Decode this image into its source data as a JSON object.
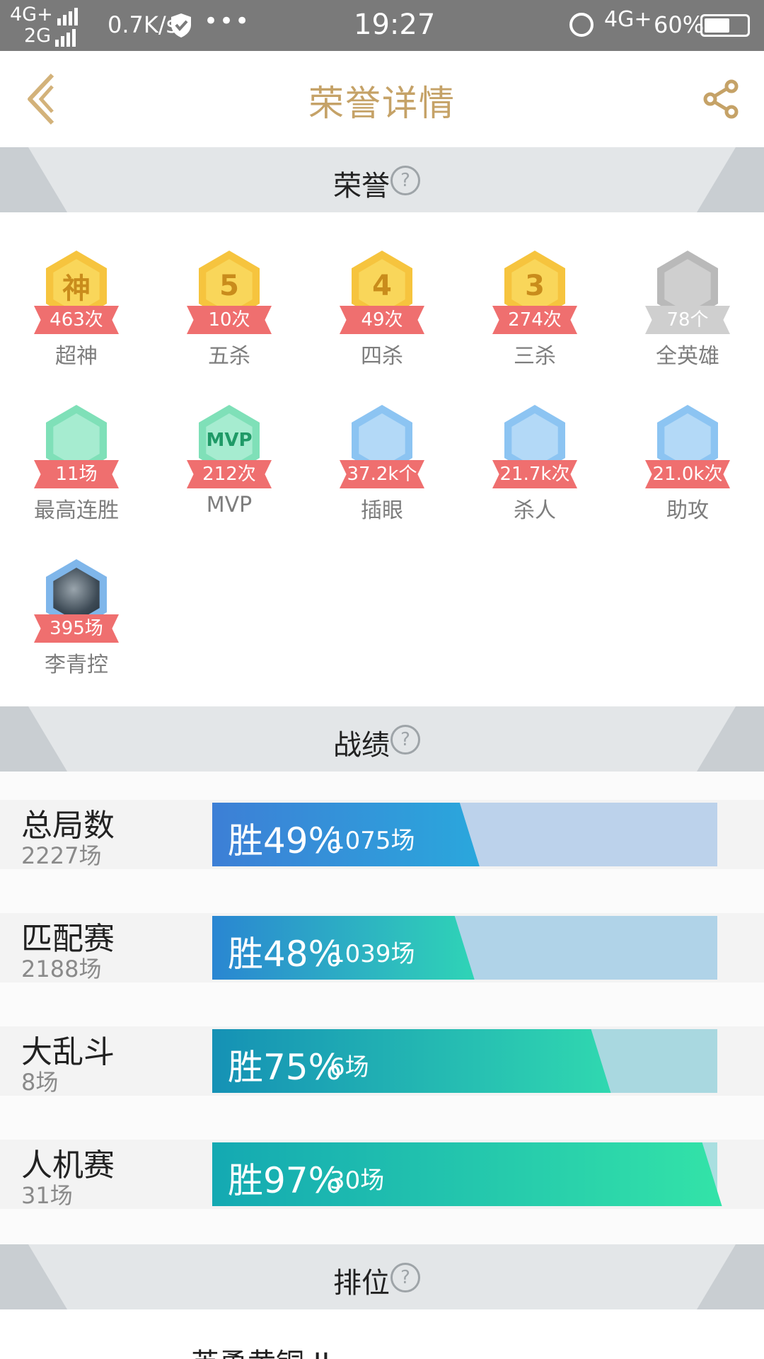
{
  "status_bar": {
    "network_top": "4G+",
    "network_bottom": "2G",
    "speed": "0.7K/s",
    "more": "•••",
    "time": "19:27",
    "network_right": "4G+",
    "battery_pct": "60%",
    "battery_level": 0.6
  },
  "header": {
    "title": "荣誉详情",
    "back_icon": "chevron-left-icon",
    "share_icon": "share-icon",
    "accent_color": "#c5a267"
  },
  "sections": {
    "honor": "荣誉",
    "records": "战绩",
    "rank": "排位",
    "help": "?"
  },
  "honors": [
    {
      "glyph": "神",
      "count": "463次",
      "label": "超神",
      "style": "gold",
      "icon": "legendary-badge-icon"
    },
    {
      "glyph": "5",
      "count": "10次",
      "label": "五杀",
      "style": "gold",
      "icon": "penta-kill-badge-icon"
    },
    {
      "glyph": "4",
      "count": "49次",
      "label": "四杀",
      "style": "gold",
      "icon": "quadra-kill-badge-icon"
    },
    {
      "glyph": "3",
      "count": "274次",
      "label": "三杀",
      "style": "gold",
      "icon": "triple-kill-badge-icon"
    },
    {
      "glyph": "",
      "count": "78个",
      "label": "全英雄",
      "style": "gray",
      "icon": "helmet-badge-icon"
    },
    {
      "glyph": "",
      "count": "11场",
      "label": "最高连胜",
      "style": "green",
      "icon": "trophy-badge-icon"
    },
    {
      "glyph": "MVP",
      "count": "212次",
      "label": "MVP",
      "style": "green",
      "icon": "mvp-badge-icon"
    },
    {
      "glyph": "",
      "count": "37.2k个",
      "label": "插眼",
      "style": "blue",
      "icon": "ward-badge-icon"
    },
    {
      "glyph": "",
      "count": "21.7k次",
      "label": "杀人",
      "style": "blue",
      "icon": "kill-badge-icon"
    },
    {
      "glyph": "",
      "count": "21.0k次",
      "label": "助攻",
      "style": "blue",
      "icon": "assist-badge-icon"
    },
    {
      "glyph": "",
      "count": "395场",
      "label": "李青控",
      "style": "avatar",
      "icon": "hero-avatar-icon"
    }
  ],
  "records": [
    {
      "name": "总局数",
      "total": "2227场",
      "win_text": "胜49%",
      "wins": "1075场",
      "win_rate": 0.49,
      "color_from": "#3d7fd6",
      "color_to": "#2aa7dc",
      "track": "#bcd2eb"
    },
    {
      "name": "匹配赛",
      "total": "2188场",
      "win_text": "胜48%",
      "wins": "1039场",
      "win_rate": 0.48,
      "color_from": "#2a86d2",
      "color_to": "#2fd4b6",
      "track": "#b0d3e8"
    },
    {
      "name": "大乱斗",
      "total": "8场",
      "win_text": "胜75%",
      "wins": "6场",
      "win_rate": 0.75,
      "color_from": "#1591b5",
      "color_to": "#30d8b0",
      "track": "#a9d8e0"
    },
    {
      "name": "人机赛",
      "total": "31场",
      "win_text": "胜97%",
      "wins": "30场",
      "win_rate": 0.97,
      "color_from": "#14a9b2",
      "color_to": "#33e3a8",
      "track": "#a9dfe0"
    }
  ],
  "rank": {
    "tier": "英勇黄铜 II"
  }
}
